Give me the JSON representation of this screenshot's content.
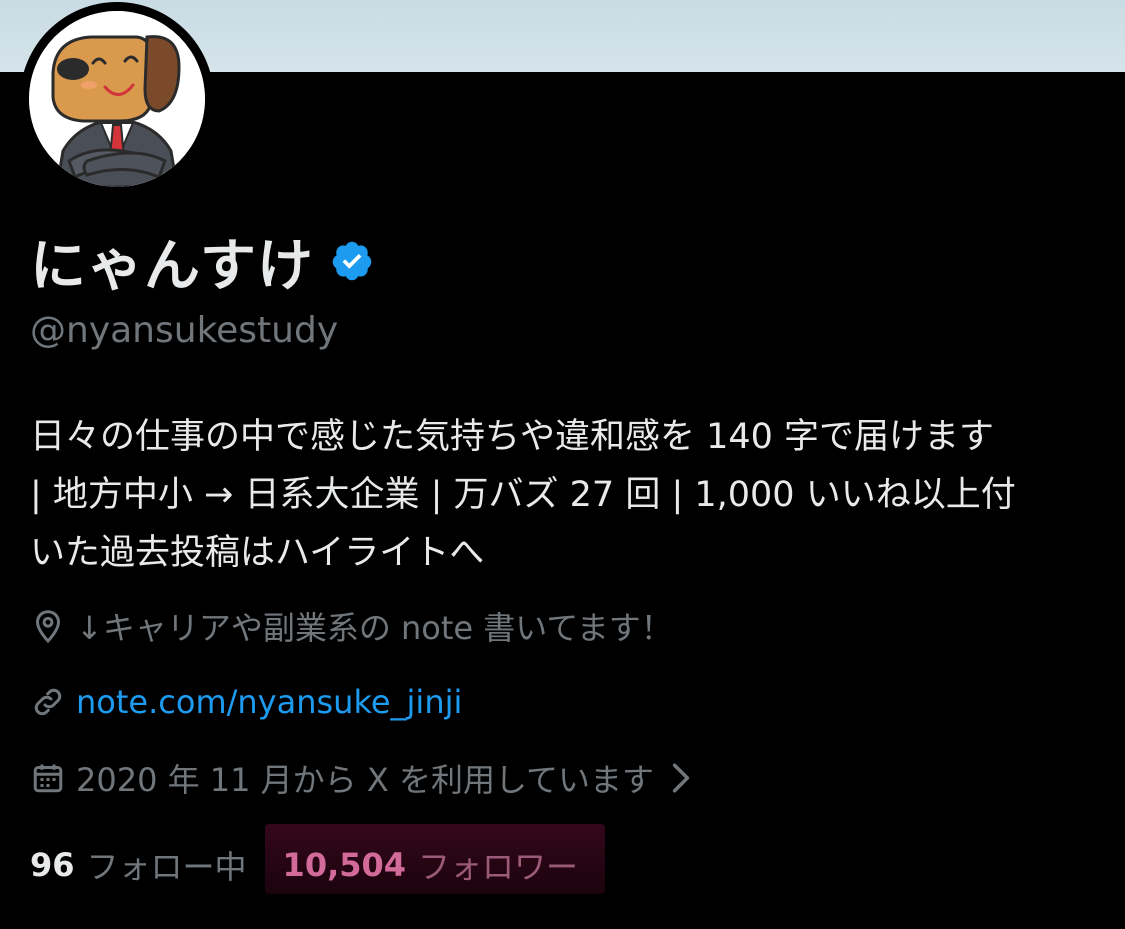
{
  "profile": {
    "display_name": "にゃんすけ",
    "handle": "@nyansukestudy",
    "verified": true,
    "verified_color": "#1d9bf0",
    "bio_lines": [
      "日々の仕事の中で感じた気持ちや違和感を 140 字で届けます",
      "| 地方中小 → 日系大企業 | 万バズ 27 回 | 1,000 いいね以上付",
      "いた過去投稿はハイライトへ"
    ],
    "location": "↓キャリアや副業系の note 書いてます！",
    "location_icon": "location-pin-icon",
    "website": "note.com/nyansuke_jinji",
    "website_icon": "link-icon",
    "joined": "2020 年 11 月から X を利用しています",
    "joined_icon": "calendar-icon"
  },
  "stats": {
    "following_count": "96",
    "following_label": "フォロー中",
    "followers_count": "10,504",
    "followers_label": "フォロワー"
  },
  "colors": {
    "background": "#000000",
    "primary_text": "#e7e9ea",
    "secondary_text": "#71767b",
    "link": "#1d9bf0"
  }
}
